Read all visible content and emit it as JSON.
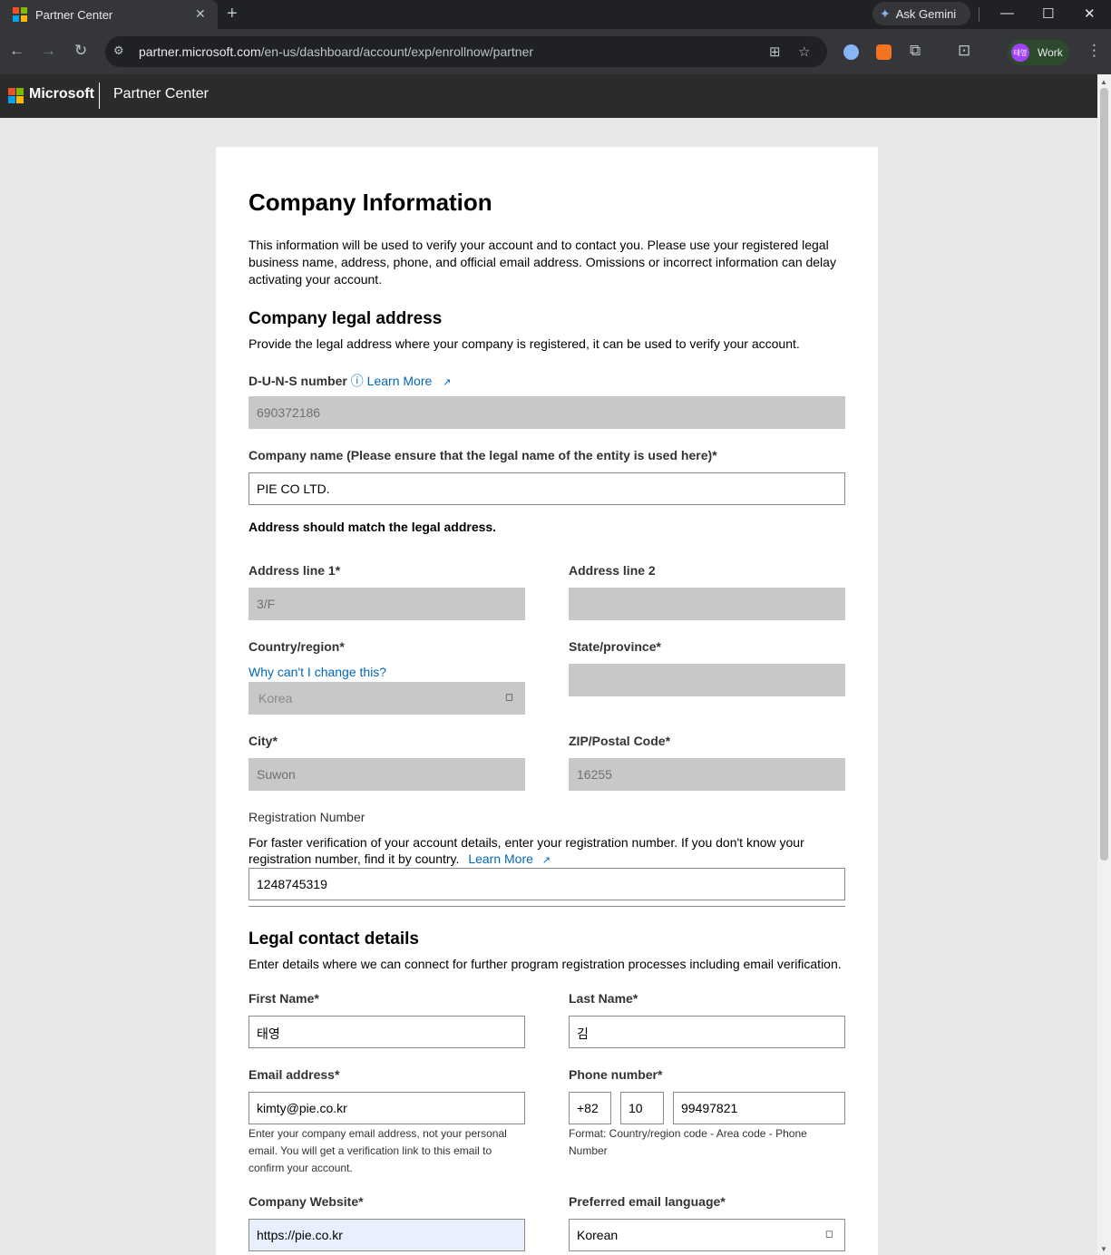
{
  "browser": {
    "tab_title": "Partner Center",
    "tab_close": "✕",
    "new_tab": "+",
    "gemini_label": "Ask Gemini",
    "url_domain": "partner.microsoft.com",
    "url_path": "/en-us/dashboard/account/exp/enrollnow/partner",
    "profile_initials": "태영",
    "profile_label": "Work",
    "minimize": "—",
    "maximize": "☐",
    "close": "✕",
    "back": "←",
    "forward": "→",
    "reload": "↻",
    "star": "☆",
    "translate": "⊞",
    "menu": "⋮"
  },
  "app": {
    "brand": "Microsoft",
    "product": "Partner Center"
  },
  "form": {
    "title": "Company Information",
    "intro": "This information will be used to verify your account and to contact you. Please use your registered legal business name, address, phone, and official email address. Omissions or incorrect information can delay activating your account.",
    "address_section_title": "Company legal address",
    "address_section_desc": "Provide the legal address where your company is registered, it can be used to verify your account.",
    "duns_label": "D-U-N-S number",
    "duns_learn_more": "Learn More",
    "duns_value": "690372186",
    "company_name_label": "Company name (Please ensure that the legal name of the entity is used here)",
    "company_name_value": "PIE CO LTD.",
    "address_note": "Address should match the legal address.",
    "address1_label": "Address line 1",
    "address1_value": "3/F",
    "address2_label": "Address line 2",
    "address2_value": "",
    "country_label": "Country/region",
    "country_help": "Why can't I change this?",
    "country_value": "Korea",
    "state_label": "State/province",
    "state_value": "",
    "city_label": "City",
    "city_value": "Suwon",
    "zip_label": "ZIP/Postal Code",
    "zip_value": "16255",
    "regnum_label": "Registration Number",
    "regnum_desc_1": "For faster verification of your account details, enter your registration number. If you don't know your",
    "regnum_desc_2": "registration number, find it by country.",
    "regnum_learn_more": "Learn More",
    "regnum_value": "1248745319",
    "contact_section_title": "Legal contact details",
    "contact_section_desc": "Enter details where we can connect for further program registration processes including email verification.",
    "first_name_label": "First Name",
    "first_name_value": "태영",
    "last_name_label": "Last Name",
    "last_name_value": "김",
    "email_label": "Email address",
    "email_value": "kimty@pie.co.kr",
    "email_hint": "Enter your company email address, not your personal email. You will get a verification link to this email to confirm your account.",
    "phone_label": "Phone number",
    "phone_country": "+82",
    "phone_area": "10",
    "phone_number": "99497821",
    "phone_hint": "Format: Country/region code - Area code - Phone Number",
    "website_label": "Company Website",
    "website_value": "https://pie.co.kr",
    "email_lang_label": "Preferred email language",
    "email_lang_value": "Korean",
    "required_mark": "*"
  },
  "colors": {
    "link": "#0067b8",
    "disabled_field": "#c8c8c8",
    "header_bg": "#2b2b2b"
  }
}
